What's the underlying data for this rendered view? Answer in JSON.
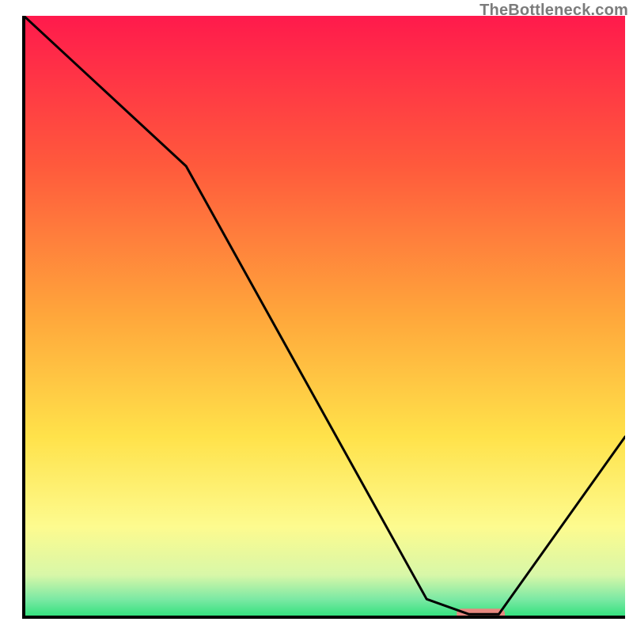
{
  "watermark": "TheBottleneck.com",
  "chart_data": {
    "type": "line",
    "title": "",
    "xlabel": "",
    "ylabel": "",
    "xlim": [
      0,
      100
    ],
    "ylim": [
      0,
      100
    ],
    "grid": false,
    "legend": false,
    "background_gradient_stops": [
      {
        "pos": 0.0,
        "color": "#ff1a4c"
      },
      {
        "pos": 0.25,
        "color": "#ff5a3c"
      },
      {
        "pos": 0.5,
        "color": "#ffa73b"
      },
      {
        "pos": 0.7,
        "color": "#ffe24a"
      },
      {
        "pos": 0.85,
        "color": "#fdfb8f"
      },
      {
        "pos": 0.93,
        "color": "#d8f7a8"
      },
      {
        "pos": 0.97,
        "color": "#7ce9a4"
      },
      {
        "pos": 1.0,
        "color": "#2fe07c"
      }
    ],
    "series": [
      {
        "name": "bottleneck-curve",
        "x": [
          0,
          27,
          67,
          74,
          79,
          100
        ],
        "values": [
          100,
          75,
          3,
          0.5,
          0.5,
          30
        ]
      }
    ],
    "marker": {
      "name": "highlight-bar",
      "x_start": 72,
      "x_end": 80,
      "y": 0.5,
      "color": "#e6887f"
    },
    "axes": {
      "left": {
        "x": 3.75,
        "y0": 97.5,
        "y1": 2.5
      },
      "bottom": {
        "y": 97.5,
        "x0": 3.75,
        "x1": 98.75
      }
    }
  }
}
